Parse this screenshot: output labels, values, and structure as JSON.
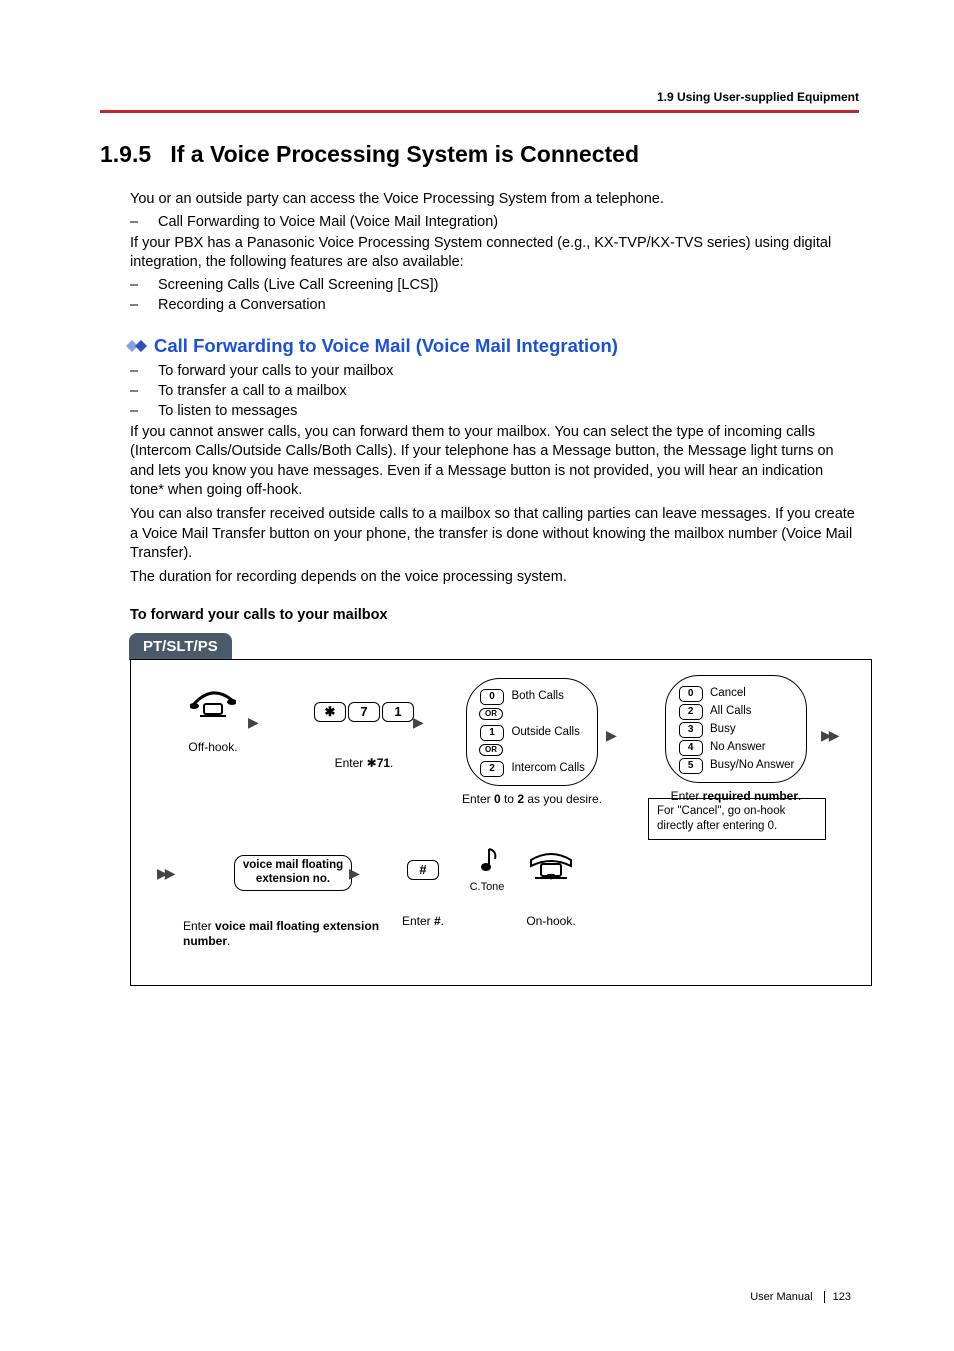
{
  "header": {
    "breadcrumb": "1.9 Using User-supplied Equipment"
  },
  "section": {
    "number": "1.9.5",
    "title": "If a Voice Processing System is Connected",
    "intro": "You or an outside party can access the Voice Processing System from a telephone.",
    "bullet1": "Call Forwarding to Voice Mail (Voice Mail Integration)",
    "para2": "If your PBX has a Panasonic Voice Processing System connected (e.g., KX-TVP/KX-TVS series) using digital integration, the following features are also available:",
    "bullet2": "Screening Calls (Live Call Screening [LCS])",
    "bullet3": "Recording a Conversation"
  },
  "subheading": {
    "title": "Call Forwarding to Voice Mail (Voice Mail Integration)",
    "b1": "To forward your calls to your mailbox",
    "b2": "To transfer a call to a mailbox",
    "b3": "To listen to messages",
    "para": "If you cannot answer calls, you can forward them to your mailbox. You can select the type of incoming calls (Intercom Calls/Outside Calls/Both Calls). If your telephone has a Message button, the Message light turns on and lets you know you have messages. Even if a Message button is not provided, you will hear an indication tone* when going off-hook.",
    "para2": "You can also transfer received outside calls to a mailbox so that calling parties can leave messages. If you create a Voice Mail Transfer button on your phone, the transfer is done without knowing the mailbox number (Voice Mail Transfer).",
    "para3": "The duration for recording depends on the voice processing system."
  },
  "procedure": {
    "title": "To forward your calls to your mailbox",
    "tab": "PT/SLT/PS",
    "step_offhook": "Off-hook.",
    "step_enter71_prefix": "Enter ",
    "step_enter71_code": "71",
    "step_enter71_suffix": ".",
    "keys71": {
      "star": "✱",
      "k7": "7",
      "k1": "1"
    },
    "options1": {
      "k0": "0",
      "l0": "Both Calls",
      "or": "OR",
      "k1": "1",
      "l1": "Outside Calls",
      "k2": "2",
      "l2": "Intercom Calls",
      "caption_a": "Enter ",
      "caption_b": "0",
      "caption_c": " to ",
      "caption_d": "2",
      "caption_e": " as you desire."
    },
    "options2": {
      "k0": "0",
      "l0": "Cancel",
      "k2": "2",
      "l2": "All Calls",
      "k3": "3",
      "l3": "Busy",
      "k4": "4",
      "l4": "No Answer",
      "k5": "5",
      "l5": "Busy/No Answer",
      "caption_a": "Enter ",
      "caption_b": "required number",
      "caption_c": "."
    },
    "note": "For \"Cancel\", go on-hook directly after entering 0.",
    "vm_line1": "voice mail floating",
    "vm_line2": "extension no.",
    "vm_caption_a": "Enter ",
    "vm_caption_b": "voice mail floating extension number",
    "vm_caption_c": ".",
    "hash": "#",
    "hash_caption_a": "Enter ",
    "hash_caption_b": "#",
    "hash_caption_c": ".",
    "ctone": "C.Tone",
    "onhook": "On-hook."
  },
  "footer": {
    "label": "User Manual",
    "page": "123"
  }
}
